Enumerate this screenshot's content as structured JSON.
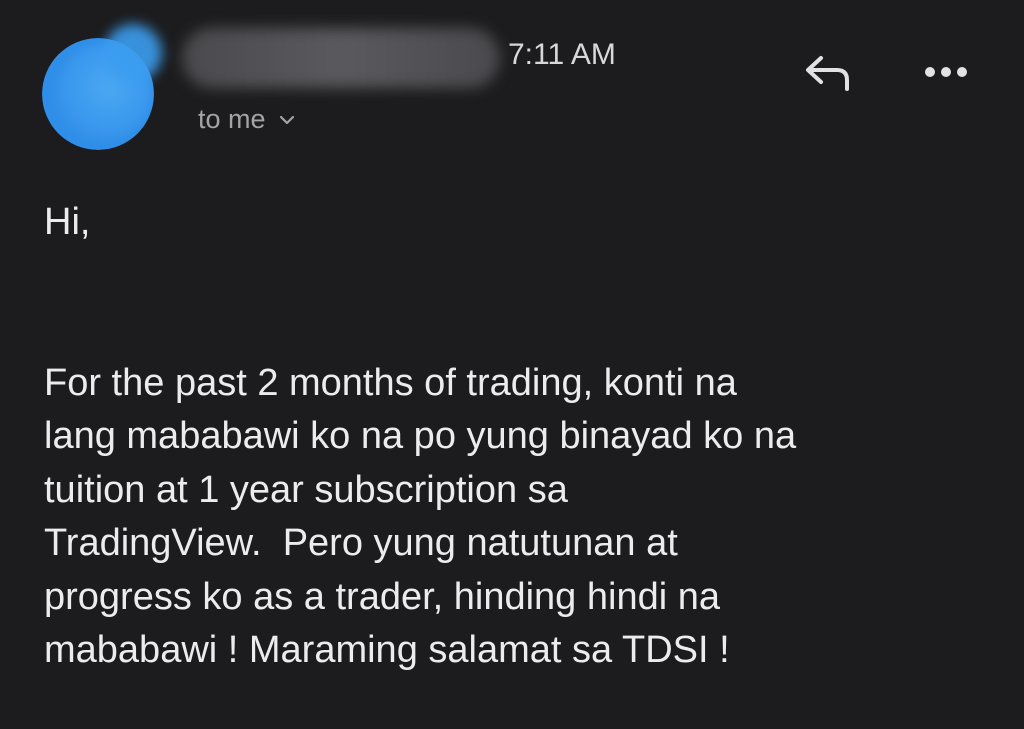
{
  "header": {
    "time": "7:11 AM",
    "recipient_label": "to me",
    "icons": {
      "avatar": "avatar",
      "reply": "reply-arrow-icon",
      "more": "more-options-icon",
      "chevron": "chevron-down-icon"
    },
    "colors": {
      "avatar": "#2f8fe8",
      "background": "#1c1c1e",
      "secondary_text": "#a3a3a8",
      "primary_text": "#ececee"
    }
  },
  "message": {
    "greeting": "Hi,",
    "lines": [
      "For the past 2 months of trading, konti na",
      "lang mababawi ko na po yung binayad ko na",
      "tuition at 1 year subscription sa",
      "TradingView.  Pero yung natutunan at",
      "progress ko as a trader, hinding hindi na",
      "mababawi ! Maraming salamat sa TDSI !"
    ]
  }
}
